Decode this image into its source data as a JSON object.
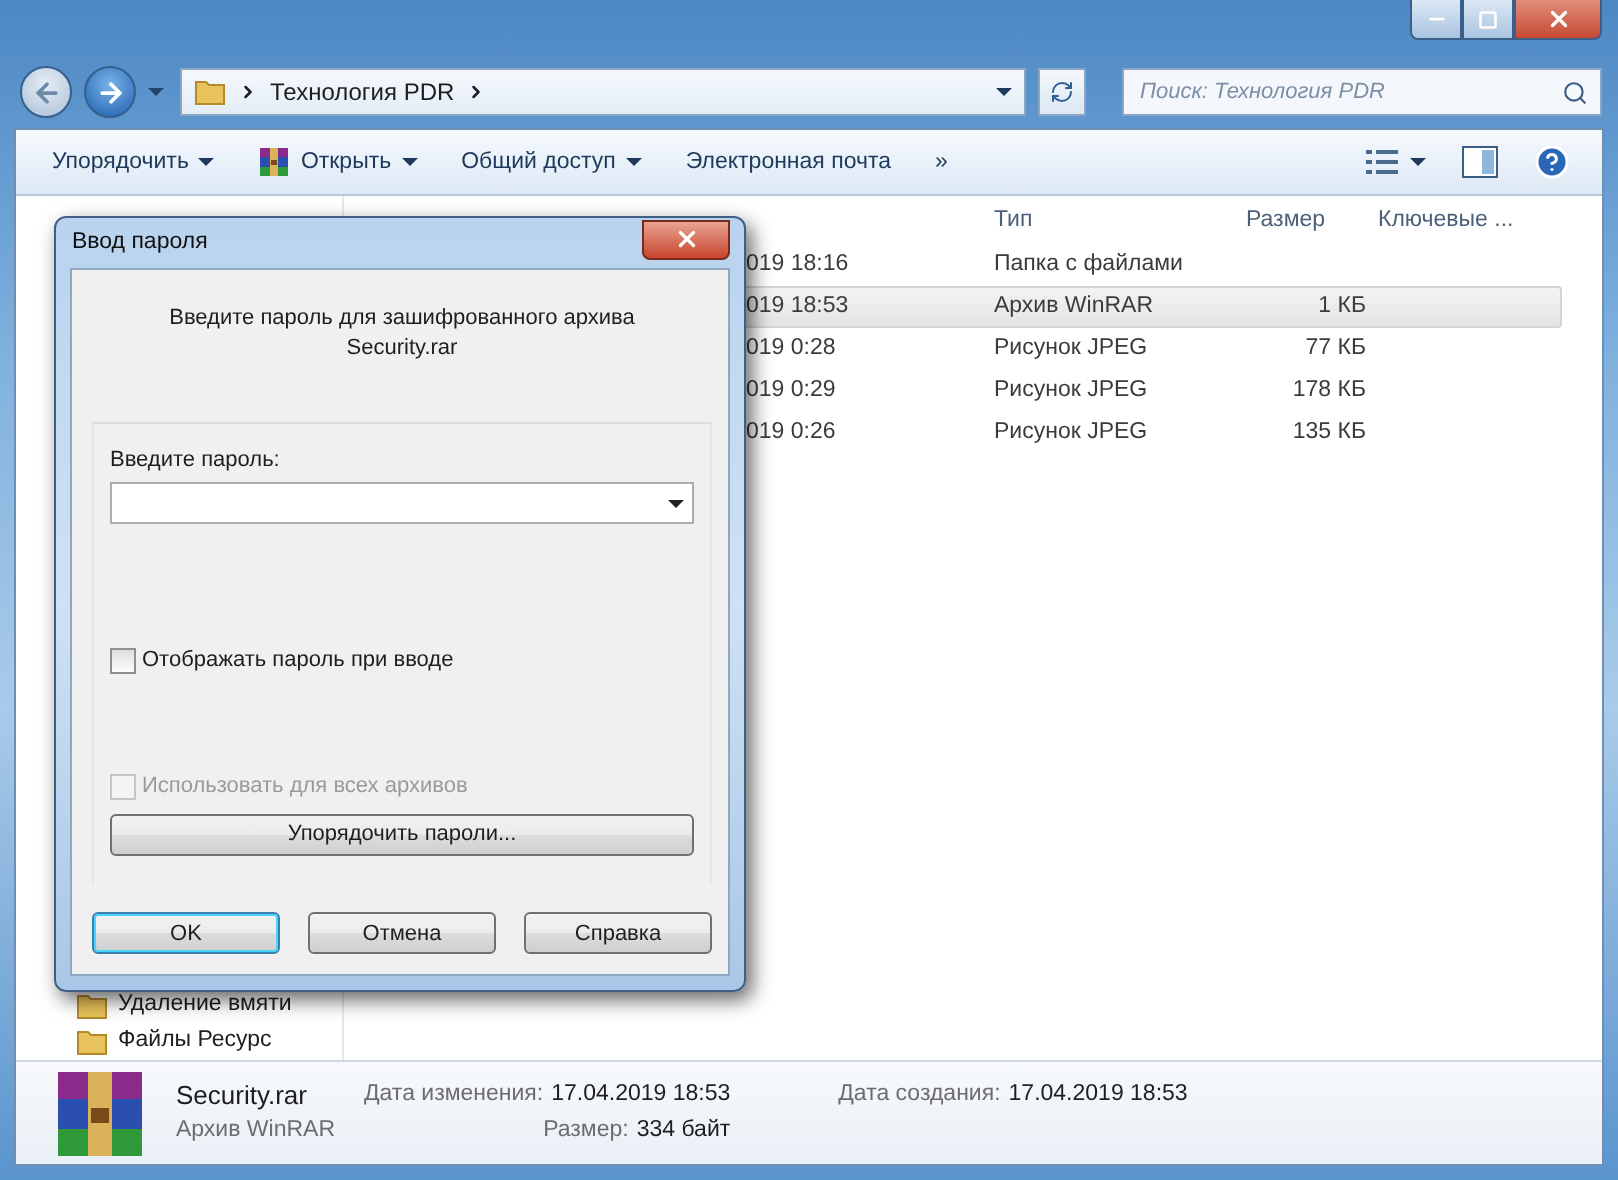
{
  "address": {
    "path": [
      "Технология PDR"
    ]
  },
  "search": {
    "placeholder": "Поиск: Технология PDR"
  },
  "toolbar": {
    "items": [
      {
        "label": "Упорядочить",
        "dropdown": true,
        "app_icon": false
      },
      {
        "label": "Открыть",
        "dropdown": true,
        "app_icon": true
      },
      {
        "label": "Общий доступ",
        "dropdown": true,
        "app_icon": false
      },
      {
        "label": "Электронная почта",
        "dropdown": false,
        "app_icon": false
      }
    ],
    "overflow": "»"
  },
  "sidebar": {
    "items": [
      {
        "label": "Удаление вмяти"
      },
      {
        "label": "Файлы Ресурс"
      }
    ]
  },
  "table": {
    "columns": [
      "Тип",
      "Размер",
      "Ключевые ..."
    ],
    "rows": [
      {
        "date": "019 18:16",
        "type": "Папка с файлами",
        "selected": false
      },
      {
        "date": "019 18:53",
        "type": "Архив WinRAR",
        "size": "1 КБ",
        "selected": true
      },
      {
        "date": "019 0:28",
        "type": "Рисунок JPEG",
        "size": "77 КБ",
        "selected": false
      },
      {
        "date": "019 0:29",
        "type": "Рисунок JPEG",
        "size": "178 КБ",
        "selected": false
      },
      {
        "date": "019 0:26",
        "type": "Рисунок JPEG",
        "size": "135 КБ",
        "selected": false
      }
    ]
  },
  "dialog": {
    "title": "Ввод пароля",
    "message": [
      "Введите пароль для зашифрованного архива",
      "Security.rar"
    ],
    "password_label": "Введите пароль:",
    "checkboxes": [
      {
        "label": "Отображать пароль при вводе",
        "checked": false,
        "disabled": false
      },
      {
        "label": "Использовать для всех архивов",
        "checked": false,
        "disabled": true
      }
    ],
    "organize_button": "Упорядочить пароли...",
    "buttons": [
      {
        "label": "OK",
        "default": true
      },
      {
        "label": "Отмена",
        "default": false
      },
      {
        "label": "Справка",
        "default": false
      }
    ]
  },
  "details": {
    "name": "Security.rar",
    "type": "Архив WinRAR",
    "fields": [
      {
        "label": "Дата изменения:",
        "value": "17.04.2019 18:53"
      },
      {
        "label": "Размер:",
        "value": "334 байт"
      },
      {
        "label": "Дата создания:",
        "value": "17.04.2019 18:53"
      }
    ]
  }
}
